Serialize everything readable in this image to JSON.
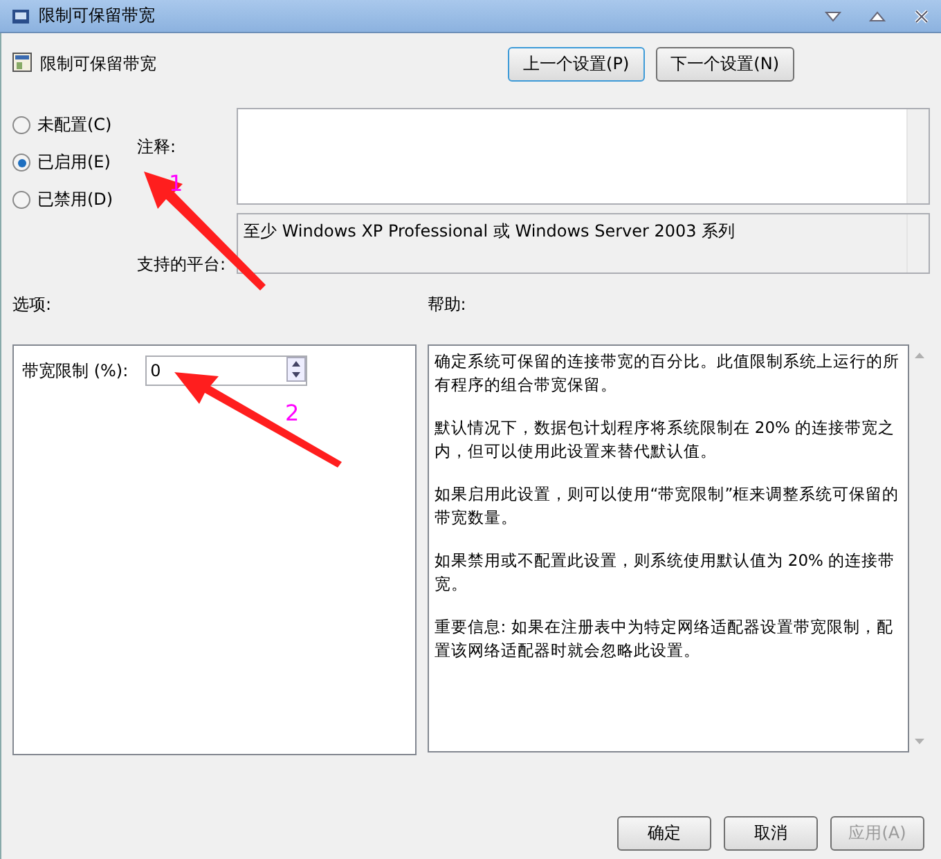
{
  "window": {
    "title": "限制可保留带宽"
  },
  "header": {
    "title": "限制可保留带宽",
    "buttons": [
      {
        "label": "上一个设置(P)",
        "focused": true
      },
      {
        "label": "下一个设置(N)",
        "focused": false
      }
    ]
  },
  "state_options": [
    {
      "label": "未配置(C)",
      "selected": false
    },
    {
      "label": "已启用(E)",
      "selected": true
    },
    {
      "label": "已禁用(D)",
      "selected": false
    }
  ],
  "comment": {
    "label": "注释:"
  },
  "platform": {
    "label": "支持的平台:",
    "value": "至少 Windows XP Professional 或 Windows Server 2003 系列"
  },
  "options": {
    "label": "选项:",
    "fields": [
      {
        "label": "带宽限制 (%):",
        "value": "0"
      }
    ]
  },
  "help": {
    "label": "帮助:",
    "paragraphs": [
      "确定系统可保留的连接带宽的百分比。此值限制系统上运行的所有程序的组合带宽保留。",
      "默认情况下，数据包计划程序将系统限制在 20% 的连接带宽之内，但可以使用此设置来替代默认值。",
      "如果启用此设置，则可以使用“带宽限制”框来调整系统可保留的带宽数量。",
      "如果禁用或不配置此设置，则系统使用默认值为 20% 的连接带宽。",
      "重要信息: 如果在注册表中为特定网络适配器设置带宽限制，配置该网络适配器时就会忽略此设置。"
    ]
  },
  "footer_buttons": [
    {
      "label": "确定",
      "disabled": false
    },
    {
      "label": "取消",
      "disabled": false
    },
    {
      "label": "应用(A)",
      "disabled": true
    }
  ],
  "annotations": [
    {
      "label": "1"
    },
    {
      "label": "2"
    }
  ]
}
